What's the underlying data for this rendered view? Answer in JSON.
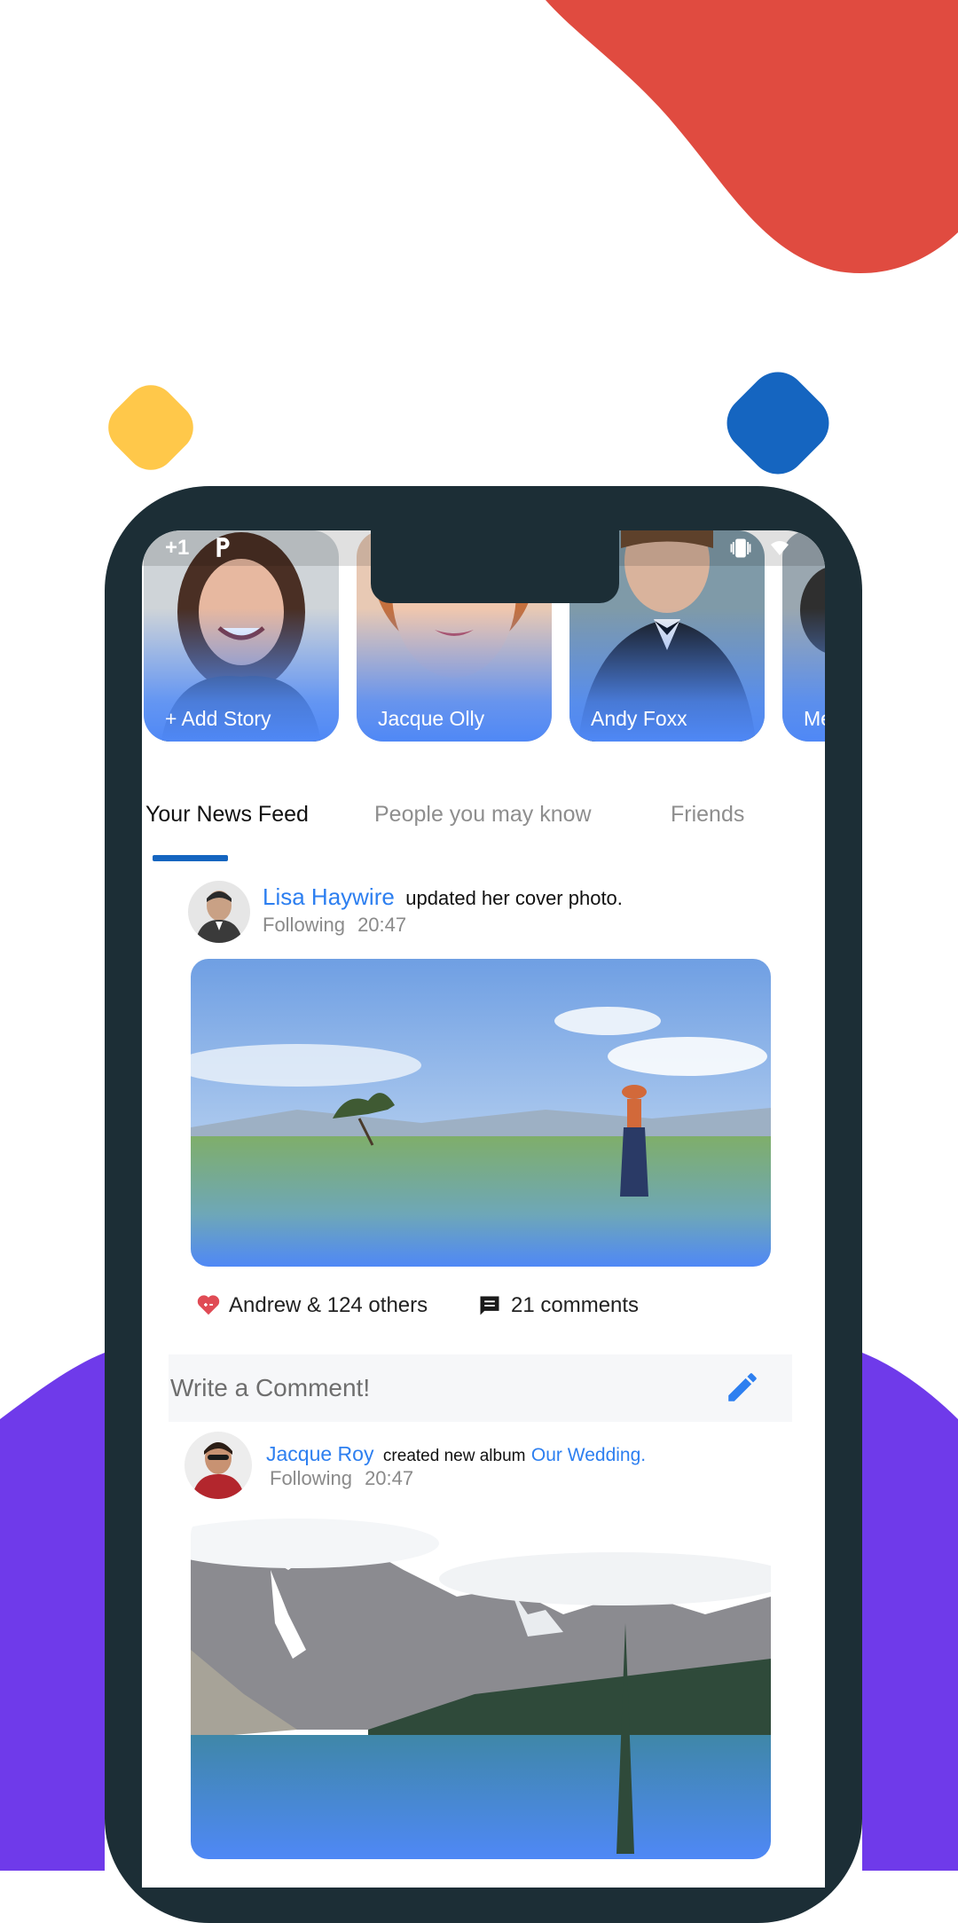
{
  "colors": {
    "accent_red": "#e04b40",
    "accent_purple": "#6f3aea",
    "accent_yellow": "#ffc84a",
    "accent_blue": "#1565c0",
    "phone_frame": "#1c2e36",
    "link_blue": "#2d7ff0"
  },
  "status_bar": {
    "left_text": "+1",
    "app_icon": "parking-icon",
    "right_icons": [
      "vibrate-icon",
      "wifi-icon"
    ]
  },
  "stories": [
    {
      "label": "+ Add Story"
    },
    {
      "label": "Jacque Olly"
    },
    {
      "label": "Andy Foxx"
    },
    {
      "label": "Me"
    }
  ],
  "tabs": [
    {
      "label": "Your News Feed",
      "active": true
    },
    {
      "label": "People you may know",
      "active": false
    },
    {
      "label": "Friends",
      "active": false
    }
  ],
  "posts": [
    {
      "author": "Lisa Haywire",
      "action": "updated her cover photo.",
      "status": "Following",
      "time": "20:47",
      "likes_text": "Andrew & 124 others",
      "comments_text": "21 comments"
    },
    {
      "author": "Jacque Roy",
      "action": "created new album",
      "album": "Our Wedding.",
      "status": "Following",
      "time": "20:47"
    }
  ],
  "comment_box": {
    "placeholder": "Write a Comment!",
    "icon": "pencil-icon"
  }
}
